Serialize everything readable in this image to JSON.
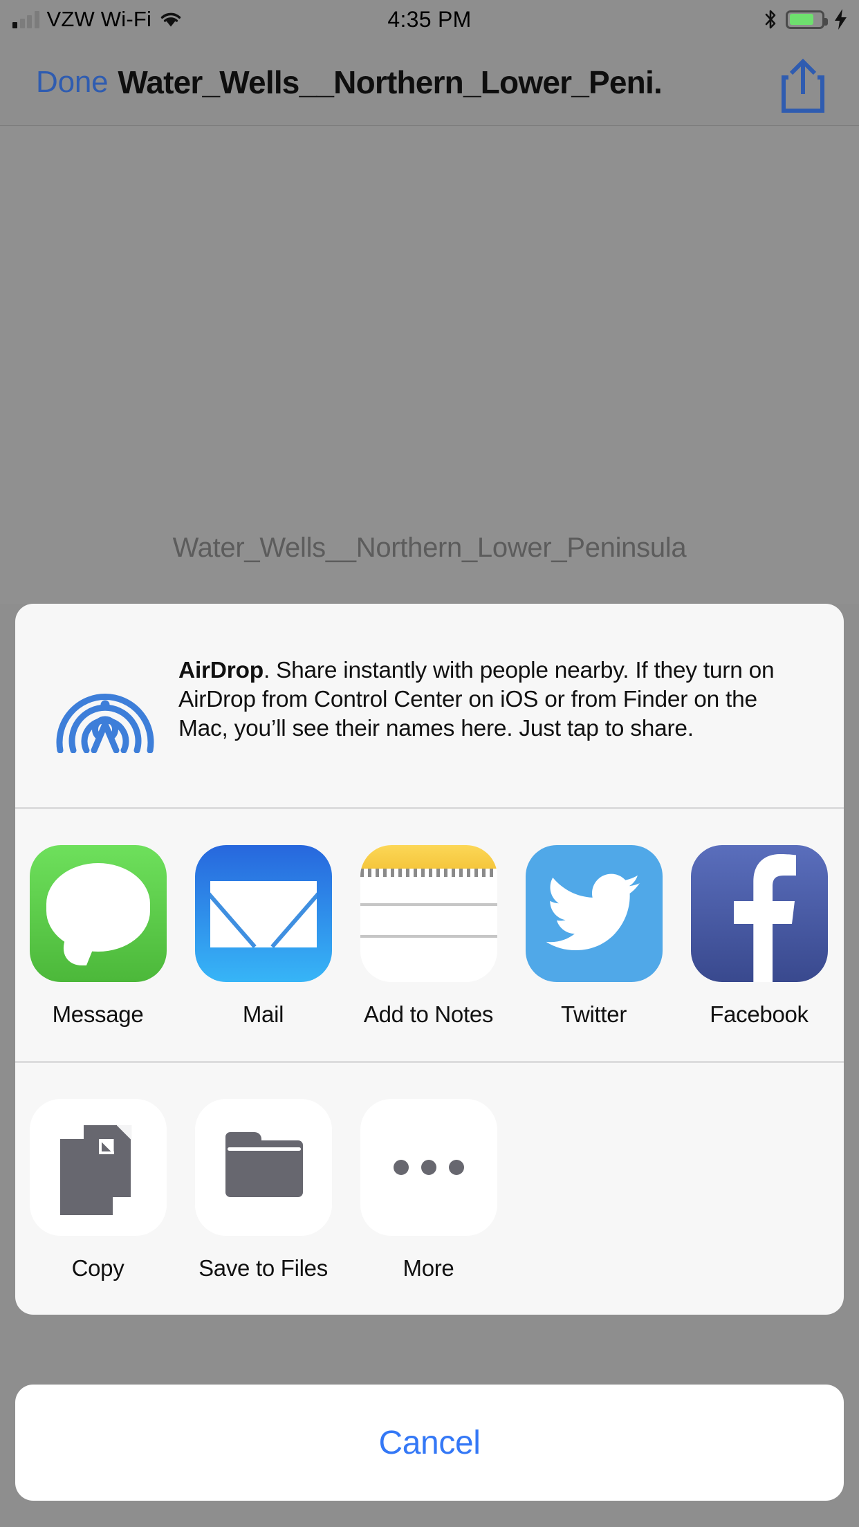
{
  "status_bar": {
    "carrier": "VZW Wi-Fi",
    "time": "4:35 PM",
    "signal_icon": "cellular-bars-icon",
    "wifi_icon": "wifi-icon",
    "bluetooth_icon": "bluetooth-icon",
    "battery_icon": "battery-icon",
    "charging_icon": "lightning-bolt-icon",
    "battery_level": "68%"
  },
  "nav_bar": {
    "done_label": "Done",
    "title": "Water_Wells__Northern_Lower_Peni...",
    "share_icon": "share-icon"
  },
  "document": {
    "filename": "Water_Wells__Northern_Lower_Peninsula"
  },
  "share_sheet": {
    "airdrop": {
      "icon": "airdrop-icon",
      "title": "AirDrop",
      "description": ". Share instantly with people nearby. If they turn on AirDrop from Control Center on iOS or from Finder on the Mac, you’ll see their names here. Just tap to share."
    },
    "apps": [
      {
        "label": "Message",
        "icon": "messages-app-icon"
      },
      {
        "label": "Mail",
        "icon": "mail-app-icon"
      },
      {
        "label": "Add to Notes",
        "icon": "notes-app-icon"
      },
      {
        "label": "Twitter",
        "icon": "twitter-app-icon"
      },
      {
        "label": "Facebook",
        "icon": "facebook-app-icon"
      }
    ],
    "actions": [
      {
        "label": "Copy",
        "icon": "copy-icon"
      },
      {
        "label": "Save to Files",
        "icon": "folder-icon"
      },
      {
        "label": "More",
        "icon": "ellipsis-icon"
      }
    ]
  },
  "cancel": {
    "label": "Cancel"
  },
  "colors": {
    "accent_blue": "#3478f6",
    "nav_blue": "#2f5cb0",
    "backdrop": "#8e8e8e",
    "sheet_bg": "#f7f7f7",
    "airdrop_blue": "#3d7ed9"
  }
}
